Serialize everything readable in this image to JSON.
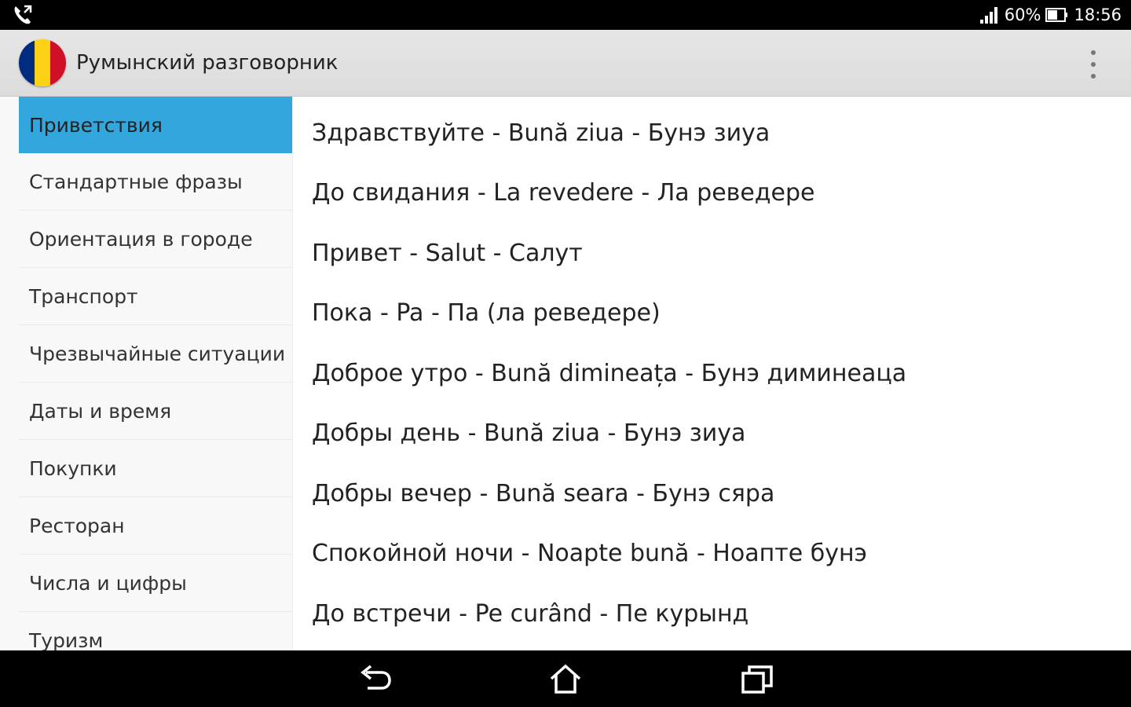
{
  "status_bar": {
    "battery_percent": "60%",
    "time": "18:56",
    "icons": [
      "phone-icon",
      "signal-icon",
      "battery-icon"
    ]
  },
  "action_bar": {
    "title": "Румынский разговорник",
    "flag_colors": [
      "#002b7f",
      "#fcd116",
      "#ce1126"
    ],
    "menu_icon": "overflow-menu-icon"
  },
  "sidebar": {
    "selected_color": "#33a7dd",
    "items": [
      {
        "label": "Приветствия",
        "selected": true
      },
      {
        "label": "Стандартные фразы",
        "selected": false
      },
      {
        "label": "Ориентация в городе",
        "selected": false
      },
      {
        "label": "Транспорт",
        "selected": false
      },
      {
        "label": "Чрезвычайные ситуации",
        "selected": false
      },
      {
        "label": "Даты и время",
        "selected": false
      },
      {
        "label": "Покупки",
        "selected": false
      },
      {
        "label": "Ресторан",
        "selected": false
      },
      {
        "label": "Числа и цифры",
        "selected": false
      },
      {
        "label": "Туризм",
        "selected": false
      }
    ]
  },
  "phrases": [
    "Здравствуйте - Bună ziua - Бунэ зиуа",
    "До свидания - La revedere - Ла реведере",
    "Привет - Salut - Салут",
    "Пока - Pa - Па (ла реведере)",
    "Доброе утро - Bună dimineața - Бунэ диминеаца",
    "Добры день - Bună ziua - Бунэ зиуа",
    "Добры вечер - Bună seara - Бунэ сяра",
    "Спокойной ночи - Noapte bună - Ноапте бунэ",
    "До встречи - Pe curând - Пе курынд"
  ],
  "nav_bar": {
    "icons": [
      "back-icon",
      "home-icon",
      "recent-apps-icon"
    ]
  }
}
